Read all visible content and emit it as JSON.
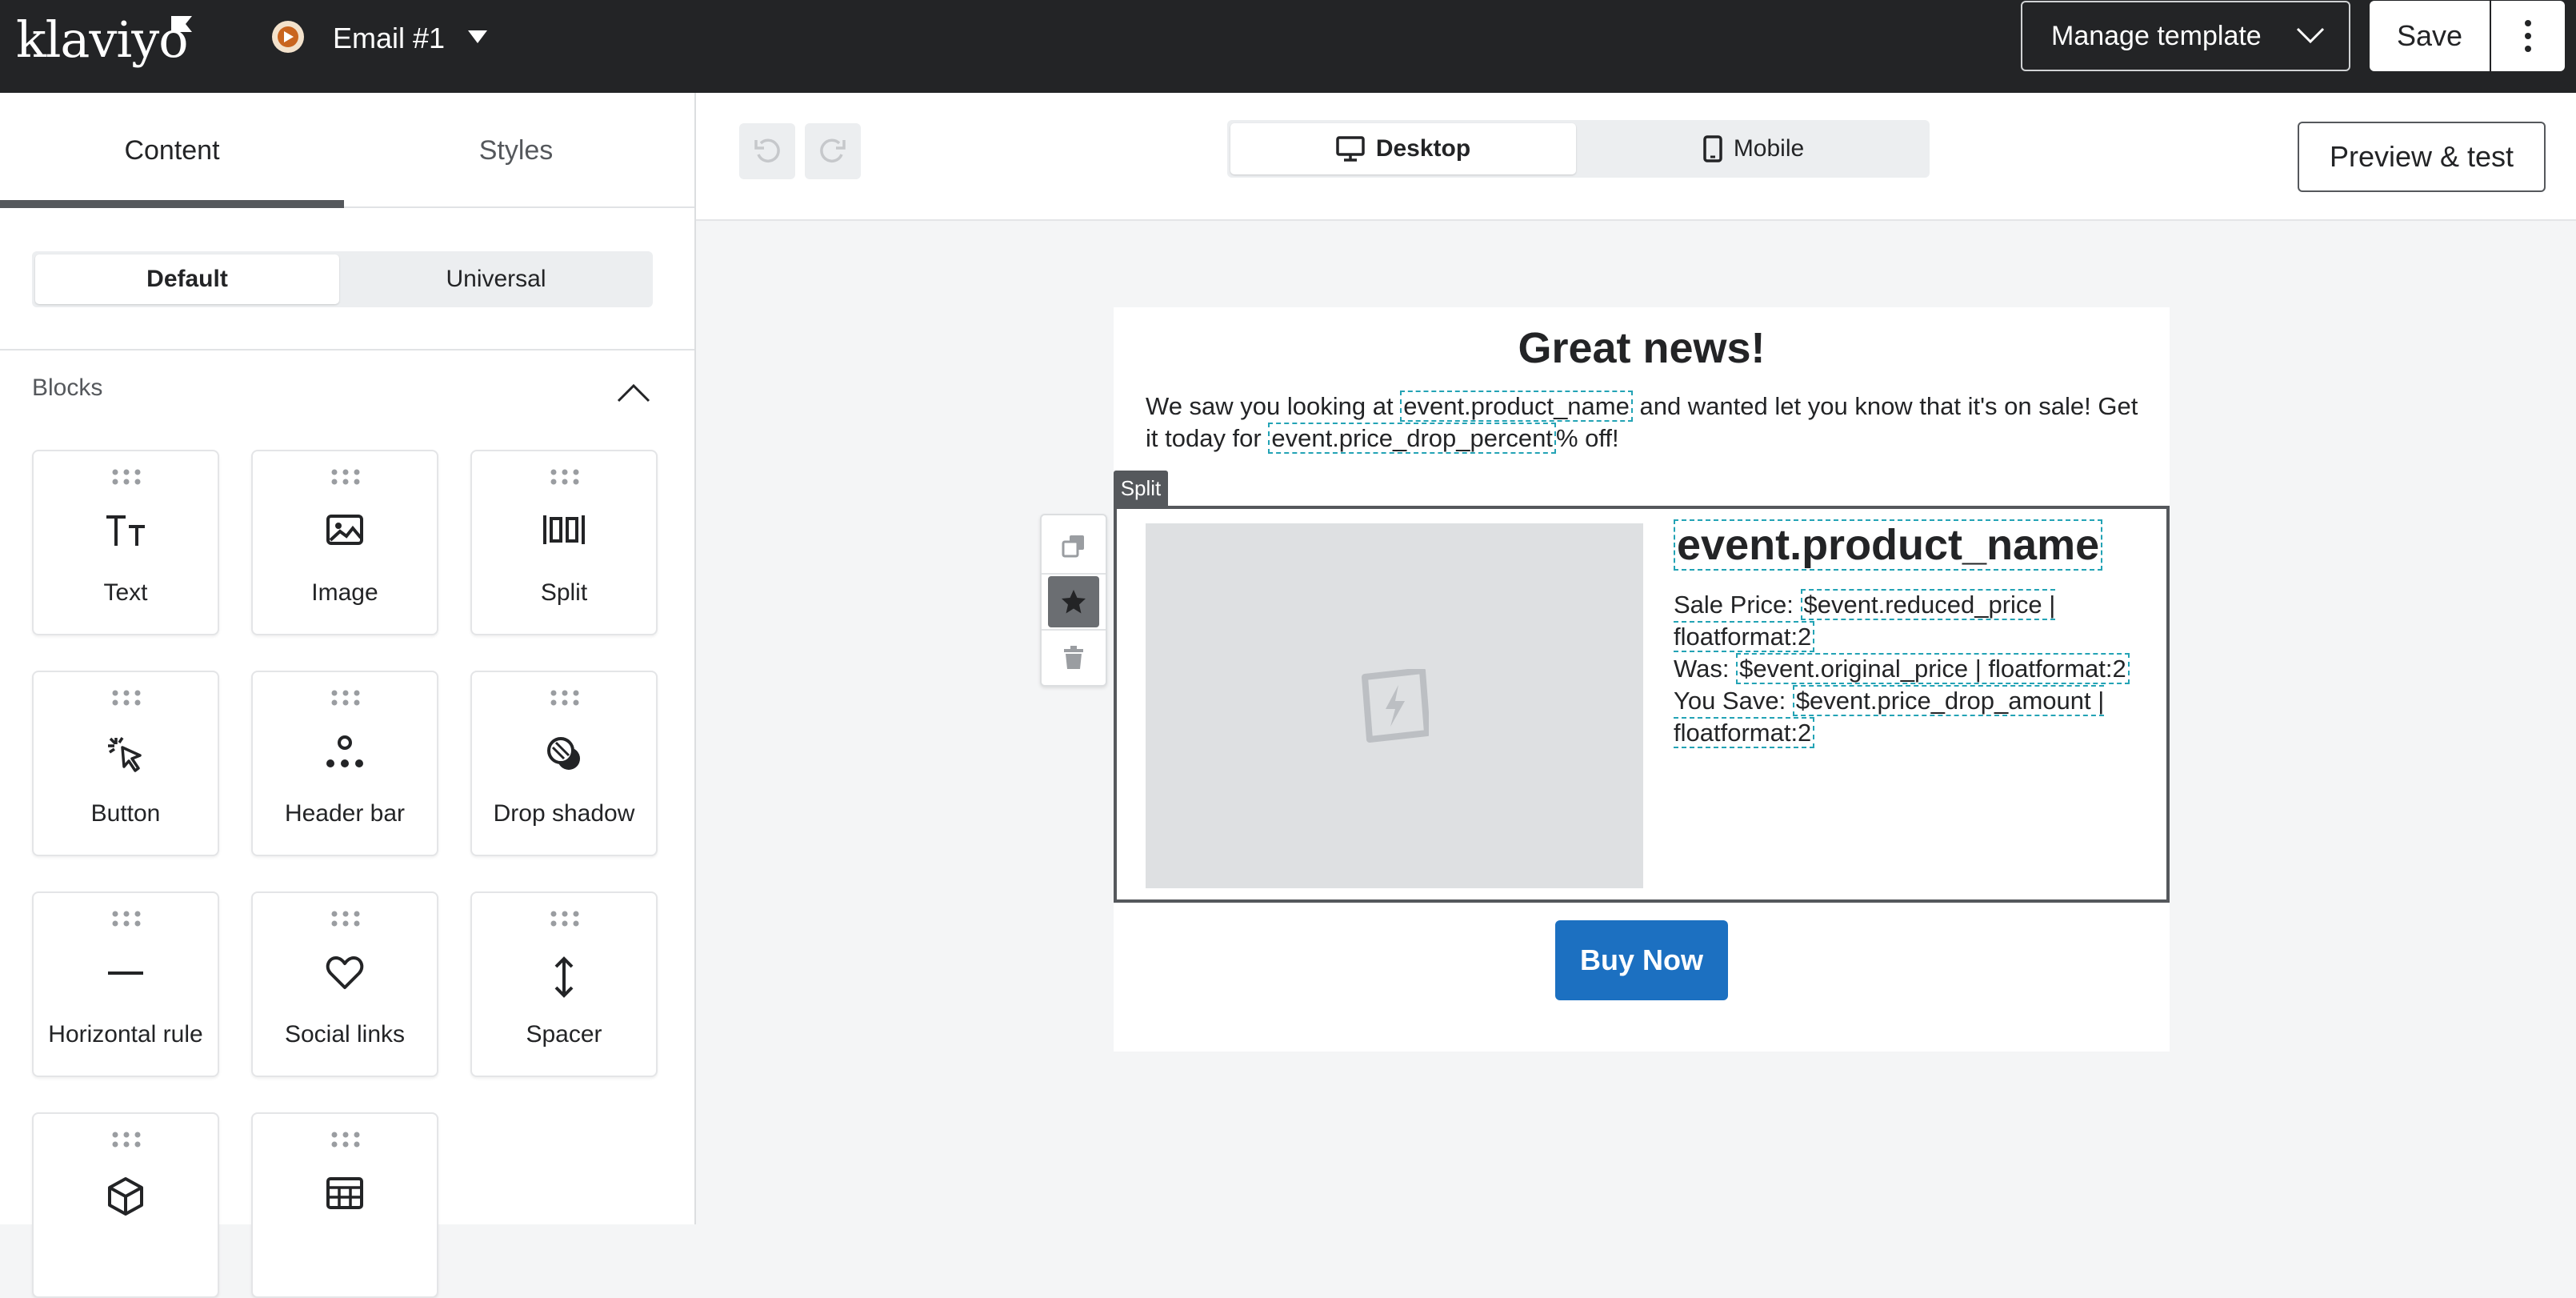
{
  "app": {
    "logo_text": "klaviyo",
    "email_name": "Email #1",
    "manage_template_label": "Manage template",
    "save_label": "Save"
  },
  "sidebar": {
    "tabs": [
      {
        "label": "Content",
        "active": true
      },
      {
        "label": "Styles",
        "active": false
      }
    ],
    "segments": [
      {
        "label": "Default",
        "active": true
      },
      {
        "label": "Universal",
        "active": false
      }
    ],
    "blocks_heading": "Blocks",
    "blocks": [
      {
        "label": "Text",
        "icon": "text-icon"
      },
      {
        "label": "Image",
        "icon": "image-icon"
      },
      {
        "label": "Split",
        "icon": "split-icon"
      },
      {
        "label": "Button",
        "icon": "button-icon"
      },
      {
        "label": "Header bar",
        "icon": "header-bar-icon"
      },
      {
        "label": "Drop shadow",
        "icon": "drop-shadow-icon"
      },
      {
        "label": "Horizontal rule",
        "icon": "horizontal-rule-icon"
      },
      {
        "label": "Social links",
        "icon": "heart-icon"
      },
      {
        "label": "Spacer",
        "icon": "spacer-icon"
      },
      {
        "label": "",
        "icon": "product-icon"
      },
      {
        "label": "",
        "icon": "table-icon"
      }
    ]
  },
  "toolbar": {
    "views": [
      {
        "label": "Desktop",
        "active": true
      },
      {
        "label": "Mobile",
        "active": false
      }
    ],
    "preview_label": "Preview & test"
  },
  "email": {
    "headline": "Great news!",
    "intro_part1": "We saw you looking at ",
    "intro_var1": "event.product_name",
    "intro_part2": " and wanted let you know that it's on sale! Get it today for ",
    "intro_var2": "event.price_drop_percent",
    "intro_part3": "% off!",
    "split_tag": "Split",
    "product_name": "event.product_name",
    "sale_prefix": "Sale Price: ",
    "sale_var": "$event.reduced_price | floatformat:2",
    "was_prefix": "Was: ",
    "was_var": "$event.original_price | floatformat:2",
    "save_prefix": "You Save: ",
    "save_var": "$event.price_drop_amount | floatformat:2",
    "buy_button": "Buy Now"
  },
  "colors": {
    "topbar": "#232426",
    "accent_button": "#1c70c1",
    "variable_outline": "#23a3b5"
  }
}
